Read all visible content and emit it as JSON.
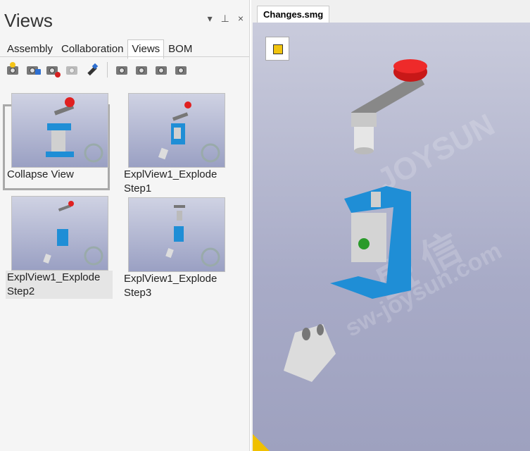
{
  "panel": {
    "title": "Views",
    "controls": [
      "▾",
      "⊥",
      "×"
    ],
    "tabs": [
      "Assembly",
      "Collaboration",
      "Views",
      "BOM"
    ],
    "active_tab": "Views"
  },
  "toolbar": {
    "icons": [
      "new-view-icon",
      "update-view-icon",
      "delete-view-icon",
      "refresh-view-icon",
      "brush-icon",
      "camera-prev-icon",
      "camera-play-icon",
      "camera-stop-icon",
      "camera-next-icon"
    ]
  },
  "views": [
    {
      "label": "Collapse View"
    },
    {
      "label": "ExplView1_Explode Step1"
    },
    {
      "label": "ExplView1_Explode Step2"
    },
    {
      "label": "ExplView1_Explode Step3"
    }
  ],
  "document": {
    "tab": "Changes.smg"
  },
  "watermark": [
    "JOYSUN",
    "盛 信",
    "sw-joysun.com"
  ]
}
